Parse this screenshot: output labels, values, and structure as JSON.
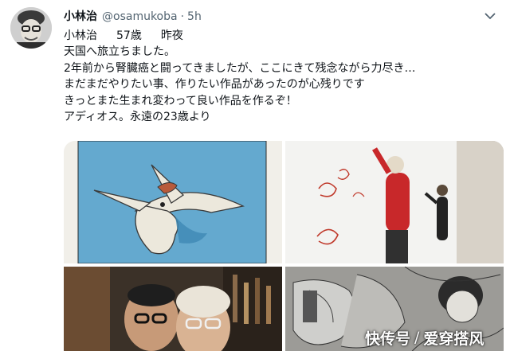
{
  "tweet": {
    "display_name": "小林治",
    "handle": "@osamukoba",
    "separator": "·",
    "time": "5h",
    "lines": {
      "first_a": "小林治",
      "first_b": "57歳",
      "first_c": "昨夜",
      "l2": "天国へ旅立ちました。",
      "l3": "2年前から腎臓癌と闘ってきましたが、ここにきて残念ながら力尽き…",
      "l4": "まだまだやりたい事、作りたい作品があったのが心残りです",
      "l5": "きっとまた生まれ変わって良い作品を作るぞ！",
      "l6": "アディオス。永遠の23歳より"
    }
  },
  "media": {
    "tiles": [
      "illustration-pterosaur",
      "wall-drawing-photo",
      "portrait-photo",
      "manga-drawing"
    ]
  },
  "watermark": {
    "left": "快传号",
    "slash": "/",
    "right": "爱穿搭风"
  },
  "colors": {
    "text": "#0f1419",
    "secondary": "#536471",
    "illustration_blue": "#64a9cf",
    "jacket_red": "#c8282a"
  }
}
